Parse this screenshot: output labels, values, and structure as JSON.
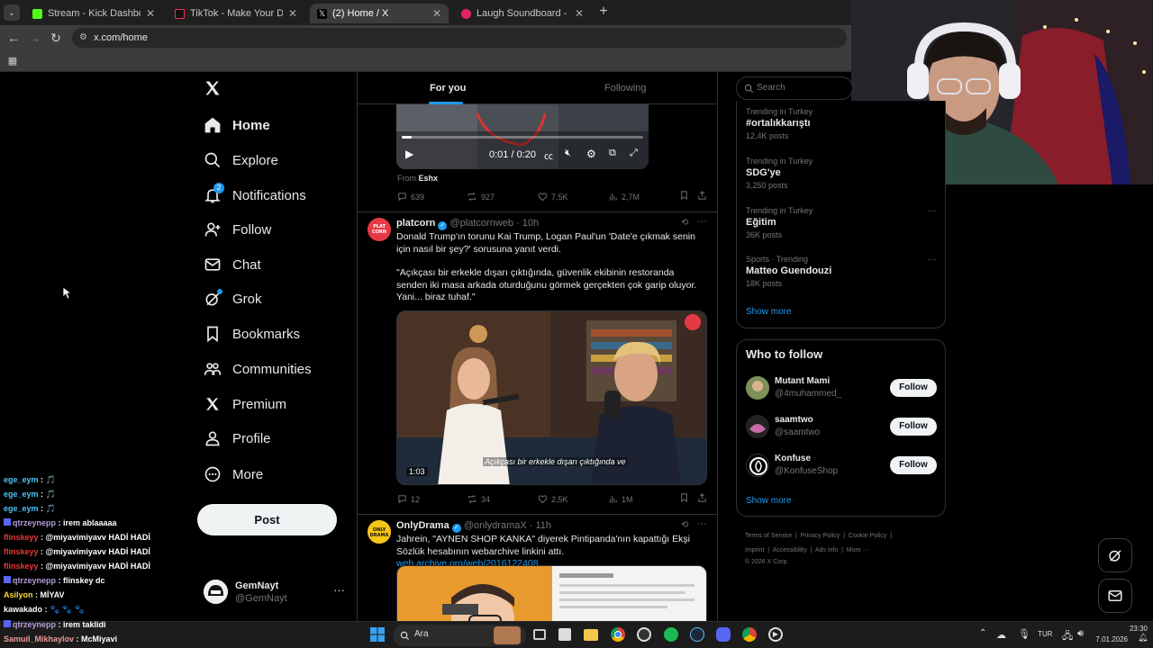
{
  "browser": {
    "tabs": [
      {
        "title": "Stream - Kick Dashboard",
        "color": "#53fc18",
        "active": false
      },
      {
        "title": "TikTok - Make Your Day",
        "color": "#222222",
        "active": false
      },
      {
        "title": "(2) Home / X",
        "color": "#ffffff",
        "active": true
      },
      {
        "title": "Laugh Soundboard - Instant So",
        "color": "#e0245e",
        "active": false
      }
    ],
    "url": "x.com/home"
  },
  "nav": {
    "items": [
      {
        "label": "Home",
        "icon": "home-icon"
      },
      {
        "label": "Explore",
        "icon": "search-icon"
      },
      {
        "label": "Notifications",
        "icon": "bell-icon",
        "badge": "2"
      },
      {
        "label": "Follow",
        "icon": "person-add-icon"
      },
      {
        "label": "Chat",
        "icon": "mail-icon"
      },
      {
        "label": "Grok",
        "icon": "grok-icon"
      },
      {
        "label": "Bookmarks",
        "icon": "bookmark-icon"
      },
      {
        "label": "Communities",
        "icon": "communities-icon"
      },
      {
        "label": "Premium",
        "icon": "x-logo-icon"
      },
      {
        "label": "Profile",
        "icon": "person-icon"
      },
      {
        "label": "More",
        "icon": "more-circle-icon"
      }
    ],
    "post_label": "Post",
    "account": {
      "name": "GemNayt",
      "handle": "@GemNayt"
    }
  },
  "feed": {
    "tabs": [
      "For you",
      "Following"
    ],
    "video1": {
      "time": "0:01 / 0:20",
      "from_label": "From",
      "from_name": "Eshx"
    },
    "tweet0_stats": {
      "replies": "639",
      "reposts": "927",
      "likes": "7,5K",
      "views": "2,7M"
    },
    "tweet1": {
      "name": "platcorn",
      "handle": "@platcornweb",
      "time": "· 10h",
      "text1": "Donald Trump'ın torunu Kai Trump, Logan Paul'un 'Date'e çıkmak senin için nasıl bir şey?' sorusuna yanıt verdi.",
      "text2": "\"Açıkçası bir erkekle dışarı çıktığında, güvenlik ekibinin restoranda senden iki masa arkada oturduğunu görmek gerçekten çok garip oluyor. Yani... biraz tuhaf.\"",
      "caption": "Açıkçası bir erkekle dışarı çıktığında ve",
      "duration": "1:03",
      "stats": {
        "replies": "12",
        "reposts": "34",
        "likes": "2,5K",
        "views": "1M"
      }
    },
    "tweet2": {
      "name": "OnlyDrama",
      "handle": "@onlydramaX",
      "time": "· 11h",
      "text": "Jahrein, \"AYNEN SHOP KANKA\" diyerek Pintipanda'nın kapattığı Ekşi Sözlük hesabının webarchive linkini attı.",
      "link": "web.archive.org/web/2016122408..."
    }
  },
  "sidebar": {
    "search_placeholder": "Search",
    "trends": [
      {
        "context": "Trending in Turkey",
        "name": "#ortalıkkarıştı",
        "count": "12,4K posts"
      },
      {
        "context": "Trending in Turkey",
        "name": "SDG'ye",
        "count": "3,250 posts"
      },
      {
        "context": "Trending in Turkey",
        "name": "Eğitim",
        "count": "36K posts"
      },
      {
        "context": "Sports · Trending",
        "name": "Matteo Guendouzi",
        "count": "18K posts"
      }
    ],
    "show_more": "Show more",
    "who_to_follow_title": "Who to follow",
    "who_to_follow": [
      {
        "name": "Mutant Mami",
        "handle": "@4muhammed_",
        "button": "Follow"
      },
      {
        "name": "saamtwo",
        "handle": "@saamtwo",
        "button": "Follow"
      },
      {
        "name": "Konfuse",
        "handle": "@KonfuseShop",
        "button": "Follow"
      }
    ],
    "footer": [
      "Terms of Service",
      "Privacy Policy",
      "Cookie Policy",
      "Imprint",
      "Accessibility",
      "Ads info",
      "More ···",
      "© 2026 X Corp."
    ]
  },
  "chat": [
    {
      "user": "ege_eym",
      "msg": "🎵",
      "color": "#4fc3f7"
    },
    {
      "user": "ege_eym",
      "msg": "🎵",
      "color": "#4fc3f7"
    },
    {
      "user": "ege_eym",
      "msg": "🎵",
      "color": "#4fc3f7"
    },
    {
      "user": "qtrzeynepp",
      "msg": "irem ablaaaaa",
      "color": "#b39ddb"
    },
    {
      "user": "flinskeyy",
      "msg": "@miyavimiyavv HADİ HADİ",
      "color": "#e53935"
    },
    {
      "user": "flinskeyy",
      "msg": "@miyavimiyavv HADİ HADİ",
      "color": "#e53935"
    },
    {
      "user": "flinskeyy",
      "msg": "@miyavimiyavv HADİ HADİ",
      "color": "#e53935"
    },
    {
      "user": "qtrzeynepp",
      "msg": "flinskey dc",
      "color": "#b39ddb"
    },
    {
      "user": "Asilyon",
      "msg": "MİYAV",
      "color": "#fdd835"
    },
    {
      "user": "kawakado",
      "msg": "🐾 🐾 🐾",
      "color": "#ffffff"
    },
    {
      "user": "qtrzeynepp",
      "msg": "irem taklidi",
      "color": "#b39ddb"
    },
    {
      "user": "Samuil_Mikhaylov",
      "msg": "McMiyavi",
      "color": "#ef9a9a"
    }
  ],
  "taskbar": {
    "search": "Ara",
    "lang": "TUR",
    "time": "23:30",
    "date": "7.01.2026"
  }
}
